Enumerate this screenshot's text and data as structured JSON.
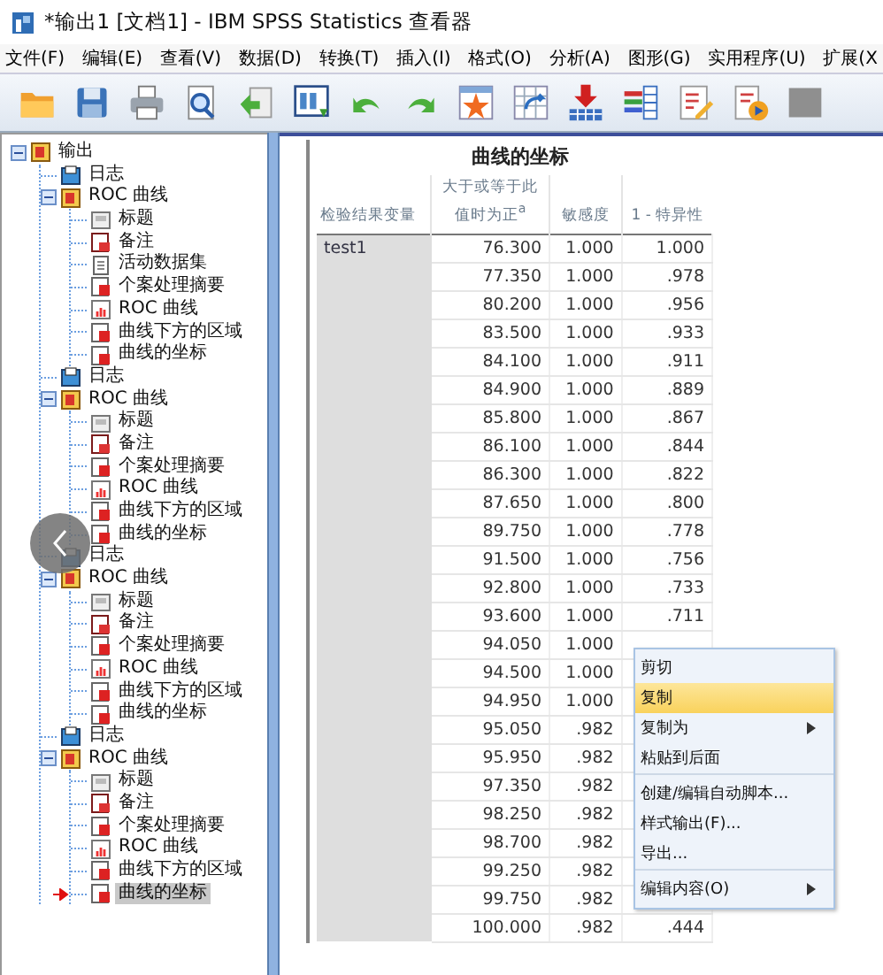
{
  "window": {
    "title": "*输出1 [文档1] - IBM SPSS Statistics 查看器"
  },
  "menubar": [
    "文件(F)",
    "编辑(E)",
    "查看(V)",
    "数据(D)",
    "转换(T)",
    "插入(I)",
    "格式(O)",
    "分析(A)",
    "图形(G)",
    "实用程序(U)",
    "扩展(X"
  ],
  "toolbar": [
    {
      "kind": "open"
    },
    {
      "kind": "save"
    },
    {
      "kind": "print"
    },
    {
      "kind": "preview"
    },
    {
      "kind": "export"
    },
    {
      "kind": "data"
    },
    {
      "kind": "undo"
    },
    {
      "kind": "redo"
    },
    {
      "kind": "star"
    },
    {
      "kind": "grid"
    },
    {
      "kind": "insert"
    },
    {
      "kind": "bars"
    },
    {
      "kind": "edit"
    },
    {
      "kind": "play"
    },
    {
      "kind": "blank"
    }
  ],
  "tree": [
    {
      "label": "输出",
      "kind": "book",
      "expanded": true,
      "selected": false,
      "children": [
        {
          "label": "日志",
          "kind": "log",
          "selected": false
        },
        {
          "label": "ROC 曲线",
          "kind": "book",
          "expanded": true,
          "selected": false,
          "children": [
            {
              "label": "标题",
              "kind": "title",
              "selected": false
            },
            {
              "label": "备注",
              "kind": "notes",
              "selected": false
            },
            {
              "label": "活动数据集",
              "kind": "page",
              "selected": false
            },
            {
              "label": "个案处理摘要",
              "kind": "table",
              "selected": false
            },
            {
              "label": "ROC 曲线",
              "kind": "chart",
              "selected": false
            },
            {
              "label": "曲线下方的区域",
              "kind": "table",
              "selected": false
            },
            {
              "label": "曲线的坐标",
              "kind": "table",
              "selected": false
            }
          ]
        },
        {
          "label": "日志",
          "kind": "log",
          "selected": false
        },
        {
          "label": "ROC 曲线",
          "kind": "book",
          "expanded": true,
          "selected": false,
          "children": [
            {
              "label": "标题",
              "kind": "title",
              "selected": false
            },
            {
              "label": "备注",
              "kind": "notes",
              "selected": false
            },
            {
              "label": "个案处理摘要",
              "kind": "table",
              "selected": false
            },
            {
              "label": "ROC 曲线",
              "kind": "chart",
              "selected": false
            },
            {
              "label": "曲线下方的区域",
              "kind": "table",
              "selected": false
            },
            {
              "label": "曲线的坐标",
              "kind": "table",
              "selected": false
            }
          ]
        },
        {
          "label": "日志",
          "kind": "log",
          "selected": false
        },
        {
          "label": "ROC 曲线",
          "kind": "book",
          "expanded": true,
          "selected": false,
          "children": [
            {
              "label": "标题",
              "kind": "title",
              "selected": false
            },
            {
              "label": "备注",
              "kind": "notes",
              "selected": false
            },
            {
              "label": "个案处理摘要",
              "kind": "table",
              "selected": false
            },
            {
              "label": "ROC 曲线",
              "kind": "chart",
              "selected": false
            },
            {
              "label": "曲线下方的区域",
              "kind": "table",
              "selected": false
            },
            {
              "label": "曲线的坐标",
              "kind": "table",
              "selected": false
            }
          ]
        },
        {
          "label": "日志",
          "kind": "log",
          "selected": false
        },
        {
          "label": "ROC 曲线",
          "kind": "book",
          "expanded": true,
          "selected": false,
          "children": [
            {
              "label": "标题",
              "kind": "title",
              "selected": false
            },
            {
              "label": "备注",
              "kind": "notes",
              "selected": false
            },
            {
              "label": "个案处理摘要",
              "kind": "table",
              "selected": false
            },
            {
              "label": "ROC 曲线",
              "kind": "chart",
              "selected": false
            },
            {
              "label": "曲线下方的区域",
              "kind": "table",
              "selected": false
            },
            {
              "label": "曲线的坐标",
              "kind": "table",
              "selected": true
            }
          ]
        }
      ]
    }
  ],
  "table": {
    "title": "曲线的坐标",
    "columns": [
      "检验结果变量",
      "大于或等于此值时为正$^{a}$",
      "敏感度",
      "1 - 特异性"
    ],
    "rows": [
      [
        "test1",
        "76.300",
        "1.000",
        "1.000"
      ],
      [
        "",
        "77.350",
        "1.000",
        ".978"
      ],
      [
        "",
        "80.200",
        "1.000",
        ".956"
      ],
      [
        "",
        "83.500",
        "1.000",
        ".933"
      ],
      [
        "",
        "84.100",
        "1.000",
        ".911"
      ],
      [
        "",
        "84.900",
        "1.000",
        ".889"
      ],
      [
        "",
        "85.800",
        "1.000",
        ".867"
      ],
      [
        "",
        "86.100",
        "1.000",
        ".844"
      ],
      [
        "",
        "86.300",
        "1.000",
        ".822"
      ],
      [
        "",
        "87.650",
        "1.000",
        ".800"
      ],
      [
        "",
        "89.750",
        "1.000",
        ".778"
      ],
      [
        "",
        "91.500",
        "1.000",
        ".756"
      ],
      [
        "",
        "92.800",
        "1.000",
        ".733"
      ],
      [
        "",
        "93.600",
        "1.000",
        ".711"
      ],
      [
        "",
        "94.050",
        "1.000"
      ],
      [
        "",
        "94.500",
        "1.000"
      ],
      [
        "",
        "94.950",
        "1.000"
      ],
      [
        "",
        "95.050",
        ".982"
      ],
      [
        "",
        "95.950",
        ".982"
      ],
      [
        "",
        "97.350",
        ".982"
      ],
      [
        "",
        "98.250",
        ".982"
      ],
      [
        "",
        "98.700",
        ".982"
      ],
      [
        "",
        "99.250",
        ".982"
      ],
      [
        "",
        "99.750",
        ".982"
      ],
      [
        "",
        "100.000",
        ".982",
        ".444"
      ]
    ]
  },
  "context_menu": [
    {
      "label": "剪切",
      "selected": false,
      "submenu": false
    },
    {
      "label": "复制",
      "selected": true,
      "submenu": false
    },
    {
      "label": "复制为",
      "selected": false,
      "submenu": true
    },
    {
      "label": "粘贴到后面",
      "selected": false,
      "submenu": false,
      "separator_after": true
    },
    {
      "label": "创建/编辑自动脚本...",
      "selected": false,
      "submenu": false
    },
    {
      "label": "样式输出(F)...",
      "selected": false,
      "submenu": false
    },
    {
      "label": "导出...",
      "selected": false,
      "submenu": false,
      "separator_after": true
    },
    {
      "label": "编辑内容(O)",
      "selected": false,
      "submenu": true
    }
  ]
}
